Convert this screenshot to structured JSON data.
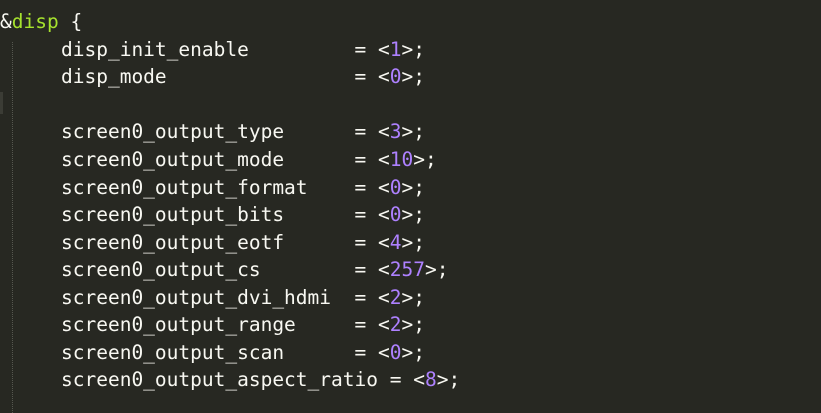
{
  "node": {
    "ampersand": "&",
    "name": "disp",
    "open_brace": " {"
  },
  "lines": [
    {
      "key": "disp_init_enable         ",
      "value": "1"
    },
    {
      "key": "disp_mode                ",
      "value": "0"
    },
    {
      "key": "screen0_output_type      ",
      "value": "3"
    },
    {
      "key": "screen0_output_mode      ",
      "value": "10"
    },
    {
      "key": "screen0_output_format    ",
      "value": "0"
    },
    {
      "key": "screen0_output_bits      ",
      "value": "0"
    },
    {
      "key": "screen0_output_eotf      ",
      "value": "4"
    },
    {
      "key": "screen0_output_cs        ",
      "value": "257"
    },
    {
      "key": "screen0_output_dvi_hdmi  ",
      "value": "2"
    },
    {
      "key": "screen0_output_range     ",
      "value": "2"
    },
    {
      "key": "screen0_output_scan      ",
      "value": "0"
    },
    {
      "key": "screen0_output_aspect_ratio ",
      "value": "8"
    }
  ],
  "syntax": {
    "assign": "= ",
    "open": "<",
    "close": ">;"
  },
  "colors": {
    "background": "#272822",
    "text": "#f8f8f2",
    "node_name": "#a6e22e",
    "number": "#ae81ff"
  }
}
